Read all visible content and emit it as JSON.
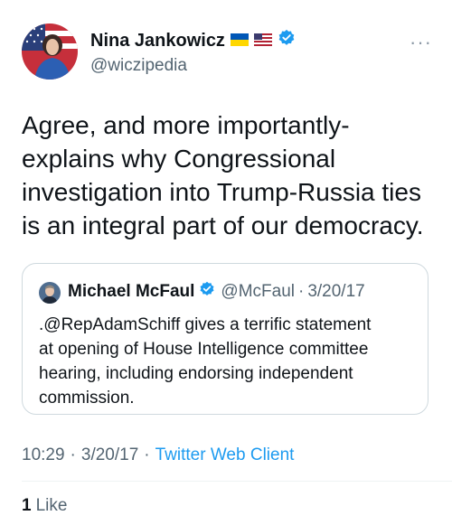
{
  "author": {
    "name": "Nina Jankowicz",
    "handle": "@wiczipedia",
    "flags": [
      "ukraine-flag-icon",
      "us-flag-icon"
    ],
    "verified": true
  },
  "tweet": {
    "lines": [
      "Agree, and more importantly-",
      "explains why Congressional",
      "investigation into Trump-Russia ties",
      "is an integral part of our democracy."
    ]
  },
  "quote": {
    "name": "Michael McFaul",
    "handle": "@McFaul",
    "separator": "·",
    "date": "3/20/17",
    "verified": true,
    "lines": [
      ".@RepAdamSchiff gives a terrific statement",
      "at opening of House Intelligence committee",
      "hearing, including endorsing independent",
      "commission."
    ]
  },
  "meta": {
    "time": "10:29",
    "separator": "·",
    "date": "3/20/17",
    "client": "Twitter Web Client"
  },
  "engagement": {
    "likes_count": "1",
    "likes_label": "Like"
  },
  "colors": {
    "text": "#0f1419",
    "secondary": "#536471",
    "accent": "#1d9bf0",
    "border": "#cfd9de"
  }
}
